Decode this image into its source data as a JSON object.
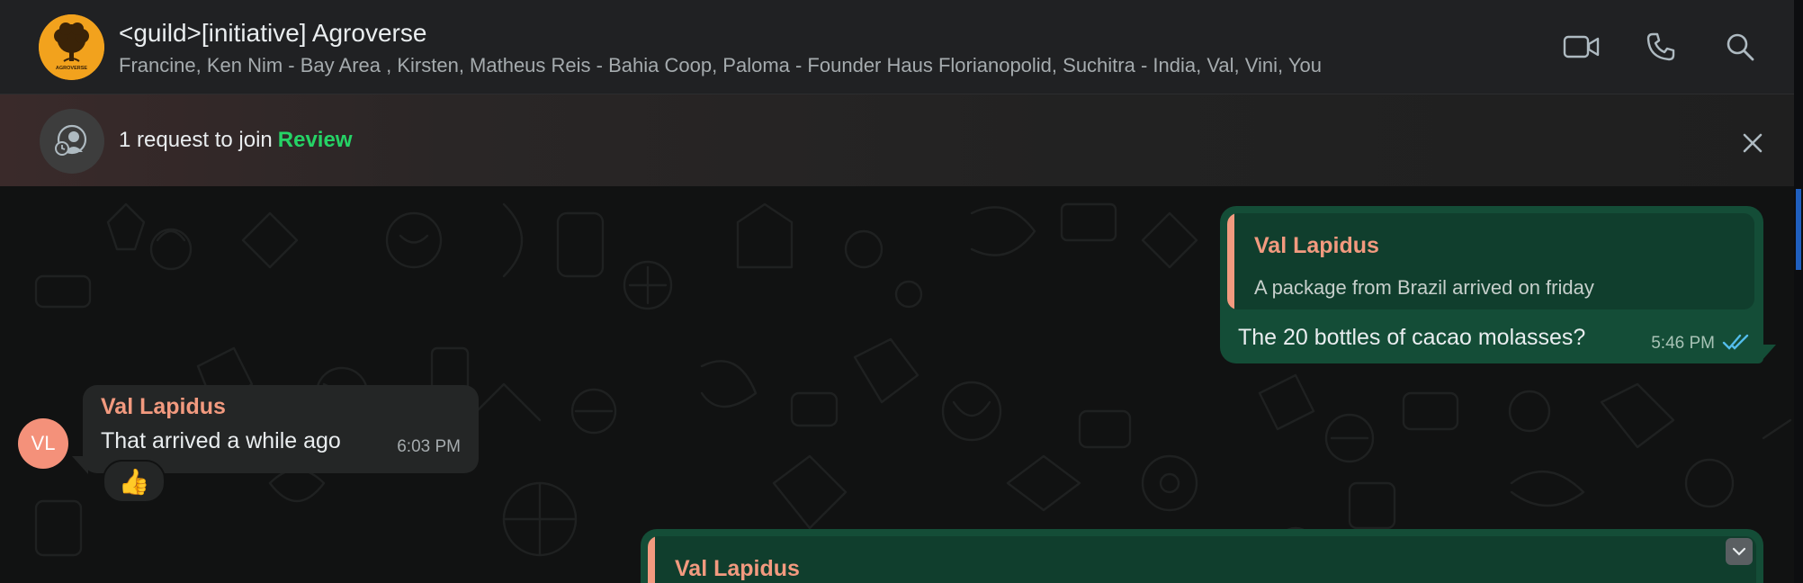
{
  "header": {
    "title": "<guild>[initiative] Agroverse",
    "members": "Francine, Ken Nim - Bay Area , Kirsten, Matheus Reis - Bahia Coop, Paloma - Founder Haus Florianopolid, Suchitra - India, Val, Vini, You",
    "avatar_label": "AGROVERSE",
    "actions": [
      "video-call",
      "voice-call",
      "search"
    ]
  },
  "banner": {
    "text": "1 request to join",
    "link_label": "Review"
  },
  "messages": [
    {
      "direction": "outgoing",
      "quote_author": "Val Lapidus",
      "quote_text": "A package from Brazil arrived on friday",
      "text": "The 20 bottles of cacao molasses?",
      "time": "5:46 PM",
      "status": "read"
    },
    {
      "direction": "incoming",
      "avatar_initials": "VL",
      "author": "Val Lapidus",
      "text": "That arrived a while ago",
      "time": "6:03 PM",
      "reaction": "👍"
    },
    {
      "direction": "outgoing",
      "quote_author": "Val Lapidus"
    }
  ],
  "colors": {
    "accent_green": "#25d366",
    "outgoing_bubble": "#144d37",
    "incoming_bubble": "#242626",
    "author_name": "#f29a7f",
    "avatar_bg": "#f4917a",
    "read_ticks": "#53bdeb"
  }
}
